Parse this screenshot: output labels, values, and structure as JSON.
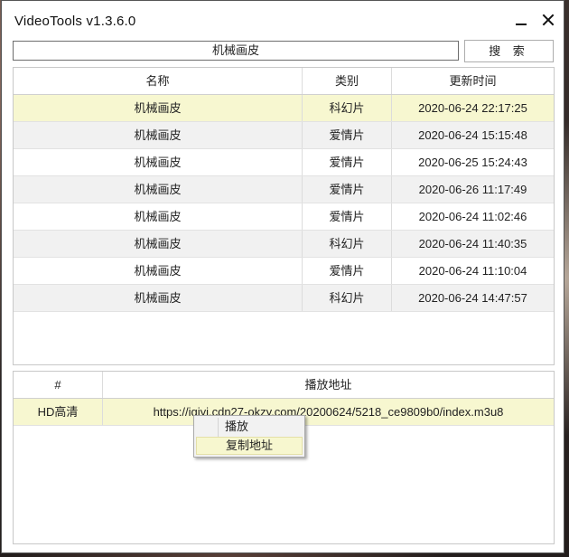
{
  "window": {
    "title": "VideoTools v1.3.6.0"
  },
  "search": {
    "value": "机械画皮",
    "button_label": "搜 索"
  },
  "results": {
    "columns": [
      "名称",
      "类别",
      "更新时间"
    ],
    "rows": [
      {
        "name": "机械画皮",
        "category": "科幻片",
        "updated": "2020-06-24 22:17:25"
      },
      {
        "name": "机械画皮",
        "category": "爱情片",
        "updated": "2020-06-24 15:15:48"
      },
      {
        "name": "机械画皮",
        "category": "爱情片",
        "updated": "2020-06-25 15:24:43"
      },
      {
        "name": "机械画皮",
        "category": "爱情片",
        "updated": "2020-06-26 11:17:49"
      },
      {
        "name": "机械画皮",
        "category": "爱情片",
        "updated": "2020-06-24 11:02:46"
      },
      {
        "name": "机械画皮",
        "category": "科幻片",
        "updated": "2020-06-24 11:40:35"
      },
      {
        "name": "机械画皮",
        "category": "爱情片",
        "updated": "2020-06-24 11:10:04"
      },
      {
        "name": "机械画皮",
        "category": "科幻片",
        "updated": "2020-06-24 14:47:57"
      }
    ]
  },
  "links": {
    "columns": [
      "#",
      "播放地址"
    ],
    "rows": [
      {
        "quality": "HD高清",
        "url": "https://iqiyi.cdn27-okzy.com/20200624/5218_ce9809b0/index.m3u8"
      }
    ]
  },
  "context_menu": {
    "items": [
      "播放",
      "复制地址"
    ],
    "highlighted": "复制地址"
  },
  "colors": {
    "selected_row": "#f7f7d0",
    "alt_row": "#f1f1f1",
    "border": "#c8c8c8"
  }
}
